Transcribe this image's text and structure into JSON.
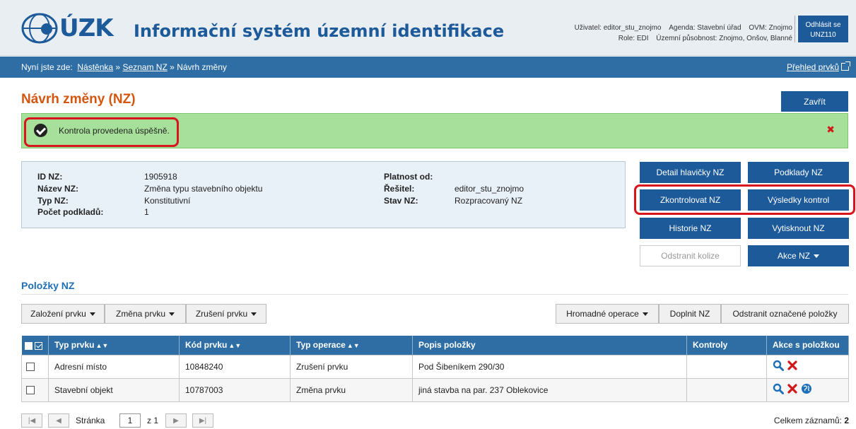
{
  "header": {
    "logo_text": "ÚZK",
    "app_title": "Informační systém územní identifikace",
    "user": "Uživatel: editor_stu_znojmo",
    "agenda": "Agenda: Stavební úřad",
    "ovm": "OVM: Znojmo",
    "role": "Role: EDI",
    "scope": "Územní působnost: Znojmo, Onšov, Blanné",
    "logout_label": "Odhlásit se",
    "user_code": "UNZ110"
  },
  "breadcrumb": {
    "prefix": "Nyní jste zde:",
    "items": [
      "Nástěnka",
      "Seznam NZ",
      "Návrh změny"
    ],
    "separator": "»",
    "overview_link": "Přehled prvků"
  },
  "page": {
    "title": "Návrh změny (NZ)",
    "close_label": "Zavřít"
  },
  "alert": {
    "message": "Kontrola provedena úspěšně.",
    "close_symbol": "✖"
  },
  "info": {
    "id_label": "ID NZ:",
    "id_value": "1905918",
    "name_label": "Název NZ:",
    "name_value": "Změna typu stavebního objektu",
    "type_label": "Typ NZ:",
    "type_value": "Konstitutivní",
    "count_label": "Počet podkladů:",
    "count_value": "1",
    "valid_label": "Platnost od:",
    "valid_value": "",
    "solver_label": "Řešitel:",
    "solver_value": "editor_stu_znojmo",
    "state_label": "Stav NZ:",
    "state_value": "Rozpracovaný NZ"
  },
  "actions": {
    "detail": "Detail hlavičky NZ",
    "sources": "Podklady NZ",
    "check": "Zkontrolovat NZ",
    "results": "Výsledky kontrol",
    "history": "Historie NZ",
    "print": "Vytisknout NZ",
    "remove_collisions": "Odstranit kolize",
    "more": "Akce NZ"
  },
  "items_section": {
    "title": "Položky NZ",
    "toolbar": {
      "create": "Založení prvku",
      "change": "Změna prvku",
      "cancel": "Zrušení prvku",
      "bulk": "Hromadné operace",
      "fill": "Doplnit NZ",
      "remove_selected": "Odstranit označené položky"
    },
    "columns": [
      "Typ prvku",
      "Kód prvku",
      "Typ operace",
      "Popis položky",
      "Kontroly",
      "Akce s položkou"
    ],
    "rows": [
      {
        "type": "Adresní místo",
        "code": "10848240",
        "operation": "Zrušení prvku",
        "desc": "Pod Šibeníkem 290/30",
        "checks": ""
      },
      {
        "type": "Stavební objekt",
        "code": "10787003",
        "operation": "Změna prvku",
        "desc": "jiná stavba na par. 237 Oblekovice",
        "checks": ""
      }
    ]
  },
  "pager": {
    "page_label": "Stránka",
    "page_value": "1",
    "of_label": "z 1",
    "total_label": "Celkem záznamů:",
    "total_value": "2"
  },
  "colors": {
    "brand": "#1d5a99",
    "nav": "#2e6ea5",
    "title": "#d4560f",
    "success_bg": "#a7e09a",
    "highlight": "#d8141c"
  }
}
